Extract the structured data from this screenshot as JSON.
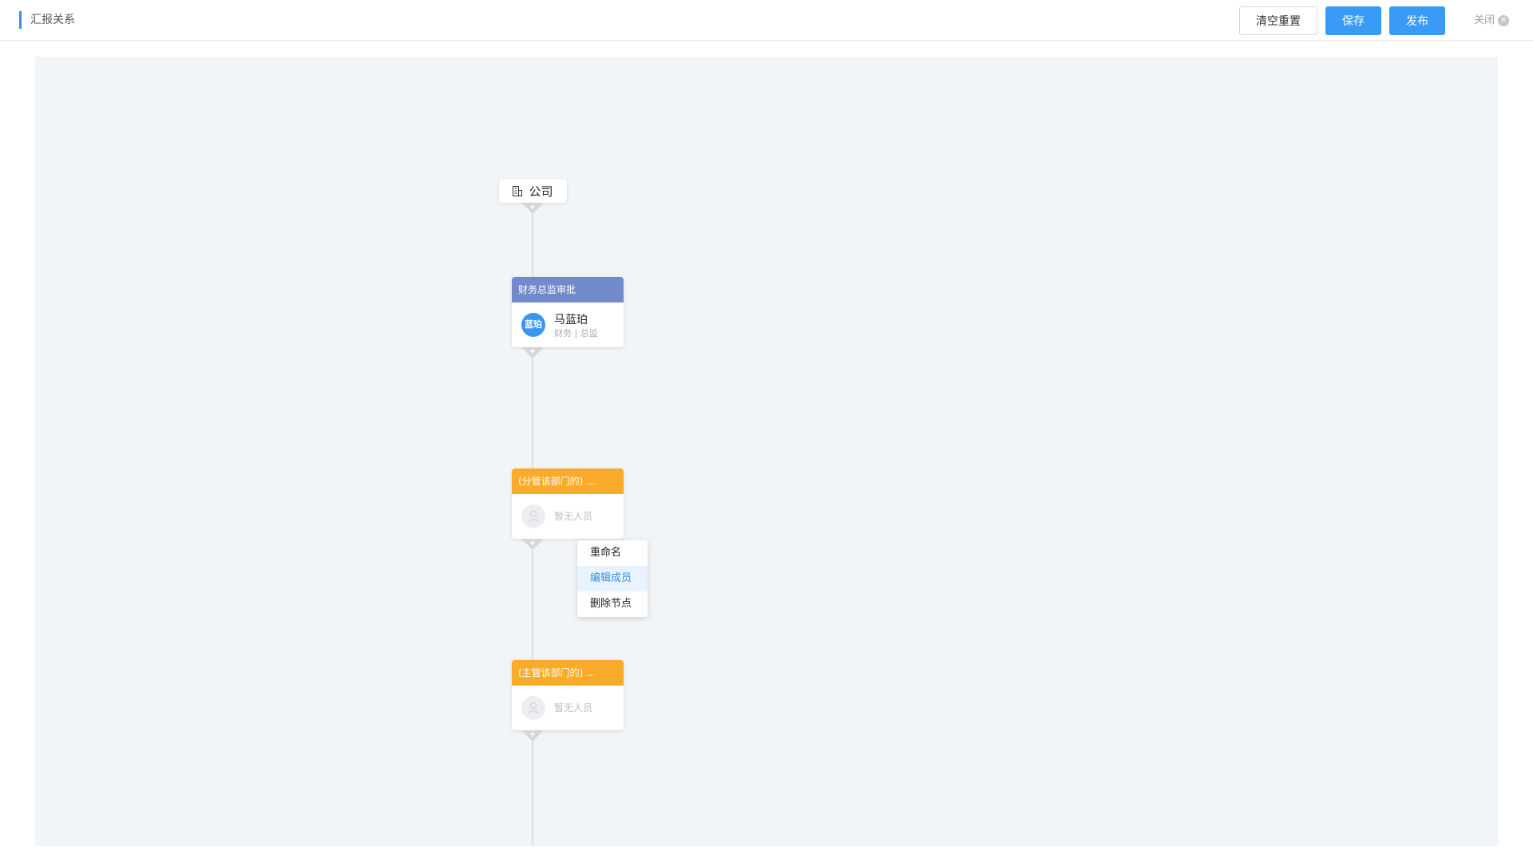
{
  "header": {
    "title": "汇报关系",
    "buttons": {
      "reset": "清空重置",
      "save": "保存",
      "publish": "发布"
    },
    "close": "关闭"
  },
  "colors": {
    "primary": "#3a9bf6",
    "node_blue": "#7289cc",
    "node_orange": "#fbab2b",
    "canvas_bg": "#f2f5f7",
    "menu_active_bg": "#e9f3ff"
  },
  "tree": {
    "root": {
      "label": "公司",
      "icon": "building-icon"
    },
    "nodes": [
      {
        "header": "财务总监审批",
        "header_color": "blue",
        "avatar_text": "蓝珀",
        "name": "马蓝珀",
        "dept": "财务 | 总监"
      },
      {
        "header": "(分管该部门的) ...",
        "header_color": "orange",
        "empty_label": "暂无人员"
      },
      {
        "header": "(主管该部门的) ...",
        "header_color": "orange",
        "empty_label": "暂无人员"
      }
    ]
  },
  "context_menu": {
    "items": [
      {
        "label": "重命名",
        "active": false
      },
      {
        "label": "编辑成员",
        "active": true
      },
      {
        "label": "删除节点",
        "active": false
      }
    ]
  }
}
